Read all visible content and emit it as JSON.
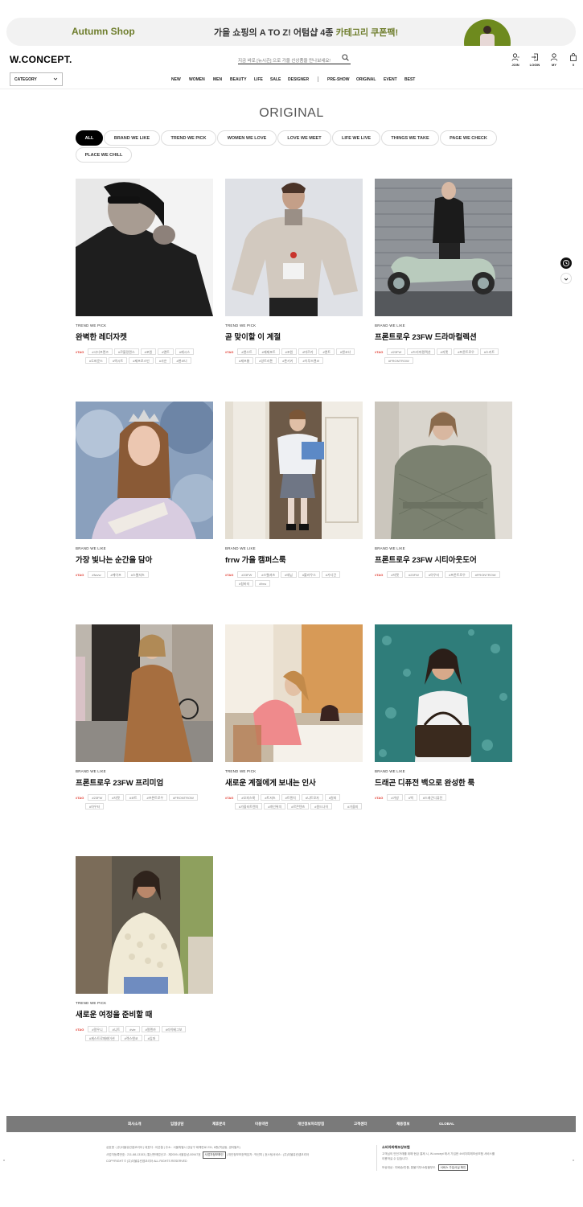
{
  "banner": {
    "left_text": "Autumn Shop",
    "center_prefix": "가을 쇼핑의 A TO Z! 어텀샵 4종 ",
    "center_highlight": "카테고리 쿠폰팩!",
    "accent_color": "#6e7d2c"
  },
  "header": {
    "logo": "W.CONCEPT.",
    "search_placeholder": "지금 바로 [뉴시즌] 으로 가을 신상품을 만나보세요!",
    "utils": [
      {
        "label": "JOIN",
        "icon": "user-plus-icon"
      },
      {
        "label": "LOGIN",
        "icon": "login-icon"
      },
      {
        "label": "MY",
        "icon": "user-icon"
      },
      {
        "label": "0",
        "icon": "shopping-bag-icon"
      }
    ],
    "category_label": "CATEGORY",
    "nav": [
      "NEW",
      "WOMEN",
      "MEN",
      "BEAUTY",
      "LIFE",
      "SALE",
      "DESIGNER",
      "PRE-SHOW",
      "ORIGINAL",
      "EVENT",
      "BEST"
    ]
  },
  "page": {
    "title": "ORIGINAL",
    "filters": [
      "ALL",
      "BRAND WE LIKE",
      "TREND WE PICK",
      "WOMEN WE LOVE",
      "LOVE WE MEET",
      "LIFE WE LIVE",
      "THINGS WE TAKE",
      "PAGE WE CHECK",
      "PLACE WE CHILL"
    ],
    "tag_label": "#TAG"
  },
  "cards": [
    {
      "category": "TREND WE PICK",
      "title": "완벽한 레더자켓",
      "tags": [
        "#시티프렌즈",
        "#르블랑퀸스",
        "#포원",
        "#앤트",
        "#제시스",
        "#도파운드",
        "#엑시트",
        "#제프로스빈",
        "#사온",
        "#앤코너"
      ]
    },
    {
      "category": "TREND WE PICK",
      "title": "곧 맞이할 이 계절",
      "tags": [
        "#앤스트",
        "#제제포트",
        "#포원",
        "#마르카",
        "#앤트",
        "#앤코너",
        "#제프롱",
        "#앙트리톤",
        "#톤키키",
        "#이루즈랜코"
      ]
    },
    {
      "category": "BRAND WE LIKE",
      "title": "프론트로우 23FW 드라마컬렉션",
      "tags": [
        "#23FW",
        "#드라마컬렉션",
        "#자켓",
        "#프론트로우",
        "#스커트",
        "#FRONTROW"
      ]
    },
    {
      "category": "BRAND WE LIKE",
      "title": "가장 빛나는 순간을 담아",
      "tags": [
        "#fwvw",
        "#케이프",
        "#스웻셔츠"
      ]
    },
    {
      "category": "BRAND WE LIKE",
      "title": "frrw 가을 캠퍼스룩",
      "tags": [
        "#23FW",
        "#스웻셔츠",
        "#데님",
        "#블라우스",
        "#가디건",
        "#청바지",
        "#frrw"
      ]
    },
    {
      "category": "BRAND WE LIKE",
      "title": "프론트로우 23FW 시티아웃도어",
      "tags": [
        "#자켓",
        "#23FW",
        "#아우터",
        "#프론트로우",
        "#FRONTROW"
      ]
    },
    {
      "category": "BRAND WE LIKE",
      "title": "프론트로우 23FW 프리미엄",
      "tags": [
        "#23FW",
        "#자켓",
        "#코트",
        "#프론트로우",
        "#FRONTROW",
        "#아우터"
      ]
    },
    {
      "category": "TREND WE PICK",
      "title": "새로운 계절에게 보내는 인사",
      "tags": [
        "#오피스룩",
        "#트셔츠",
        "#트렌치",
        "#니트모자",
        "#원피",
        "#가을터트렌치",
        "#개인위치",
        "#르콘텐츠",
        "#원드나이",
        "#가을미"
      ]
    },
    {
      "category": "BRAND WE LIKE",
      "title": "드래곤 디퓨전 백으로 완성한 룩",
      "tags": [
        "#가방",
        "#백",
        "#드래곤디퓨전"
      ]
    },
    {
      "category": "TREND WE PICK",
      "title": "새로운 여정을 준비할 때",
      "tags": [
        "#알우니",
        "#니트",
        "#vie",
        "#얼렌카",
        "#라이베그보",
        "#제스트로페레이션",
        "#렉스앤코",
        "#임파"
      ]
    }
  ],
  "footer": {
    "links": [
      "회사소개",
      "입점상담",
      "제휴문의",
      "이용약관",
      "개인정보처리방침",
      "고객센터",
      "채용정보",
      "GLOBAL"
    ],
    "info_lines": [
      "상호명 : (주)더블유컨셉코리아  |  대표자 : 이은철  |  주소 : 서울특별시 강남구 테헤란로 231, 8층(역삼동, 센터필드)",
      "사업자등록번호 : 211-88-13153  |  통신판매업신고 : 제2009-서울강남-00947호",
      "COPYRIGHT © (주)더블유컨셉코리아 ALL RIGHTS RESERVED"
    ],
    "biz_check_button": "사업자정보확인",
    "info_extra": "  |  개인정보보호책임자 : 박선미  |  호스팅서비스 : (주)더블유컨셉코리아",
    "guard_title": "소비자피해보상보험",
    "guard_text": "고객님의 안전거래를 위해 현금 결제 시, W.concept 에서 가입한 소비자피해보상보험 서비스를 이용하실 수 있습니다.",
    "guard_sub": "보상대상 : 미배송/반품, 환불거부/쇼핑몰부도",
    "guard_button": "서비스 가입사실 확인"
  },
  "float": {
    "recent_icon": "clock-icon",
    "down_icon": "chevron-down-icon"
  }
}
